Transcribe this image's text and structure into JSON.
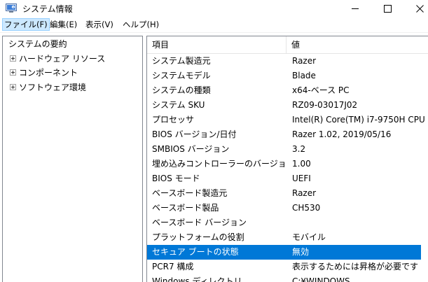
{
  "window": {
    "title": "システム情報",
    "icon": "system-info-icon"
  },
  "menu": [
    "ファイル(F)",
    "編集(E)",
    "表示(V)",
    "ヘルプ(H)"
  ],
  "tree": {
    "root": "システムの要約",
    "children": [
      "ハードウェア リソース",
      "コンポーネント",
      "ソフトウェア環境"
    ]
  },
  "table": {
    "headers": [
      "項目",
      "値"
    ],
    "rows": [
      [
        "システム製造元",
        "Razer"
      ],
      [
        "システムモデル",
        "Blade"
      ],
      [
        "システムの種類",
        "x64-ベース PC"
      ],
      [
        "システム SKU",
        "RZ09-03017J02"
      ],
      [
        "プロセッサ",
        "Intel(R) Core(TM) i7-9750H CPU"
      ],
      [
        "BIOS バージョン/日付",
        "Razer 1.02, 2019/05/16"
      ],
      [
        "SMBIOS バージョン",
        "3.2"
      ],
      [
        "埋め込みコントローラーのバージョン",
        "1.00"
      ],
      [
        "BIOS モード",
        "UEFI"
      ],
      [
        "ベースボード製造元",
        "Razer"
      ],
      [
        "ベースボード製品",
        "CH530"
      ],
      [
        "ベースボード バージョン",
        ""
      ],
      [
        "プラットフォームの役割",
        "モバイル"
      ],
      [
        "セキュア ブートの状態",
        "無効"
      ],
      [
        "PCR7 構成",
        "表示するためには昇格が必要です"
      ],
      [
        "Windows ディレクトリ",
        "C:¥WINDOWS"
      ]
    ],
    "selected_row": 13
  },
  "colors": {
    "selection": "#0078d7",
    "menu_highlight": "#cce8ff"
  }
}
